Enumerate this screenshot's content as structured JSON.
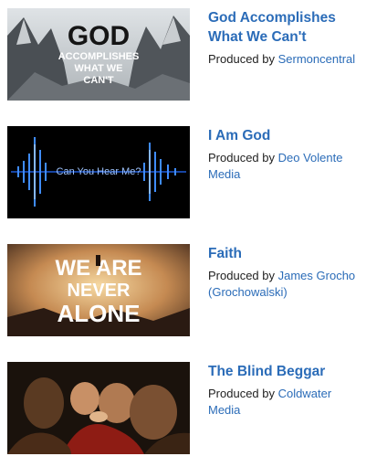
{
  "sermons": [
    {
      "title": "God Accomplishes What We Can't",
      "produced_by_label": "Produced by",
      "producer": "Sermoncentral",
      "thumbnail": {
        "line1": "GOD",
        "line2": "ACCOMPLISHES",
        "line3": "WHAT WE",
        "line4": "CAN'T"
      }
    },
    {
      "title": "I Am God",
      "produced_by_label": "Produced by",
      "producer": "Deo Volente Media",
      "thumbnail": {
        "caption": "Can You Hear Me?"
      }
    },
    {
      "title": "Faith",
      "produced_by_label": "Produced by",
      "producer": "James Grocho (Grochowalski)",
      "thumbnail": {
        "line1": "WE ARE",
        "line2": "NEVER",
        "line3": "ALONE"
      }
    },
    {
      "title": "The Blind Beggar",
      "produced_by_label": "Produced by",
      "producer": "Coldwater Media",
      "thumbnail": {}
    }
  ],
  "colors": {
    "link": "#2b6cb8",
    "text": "#222222"
  }
}
